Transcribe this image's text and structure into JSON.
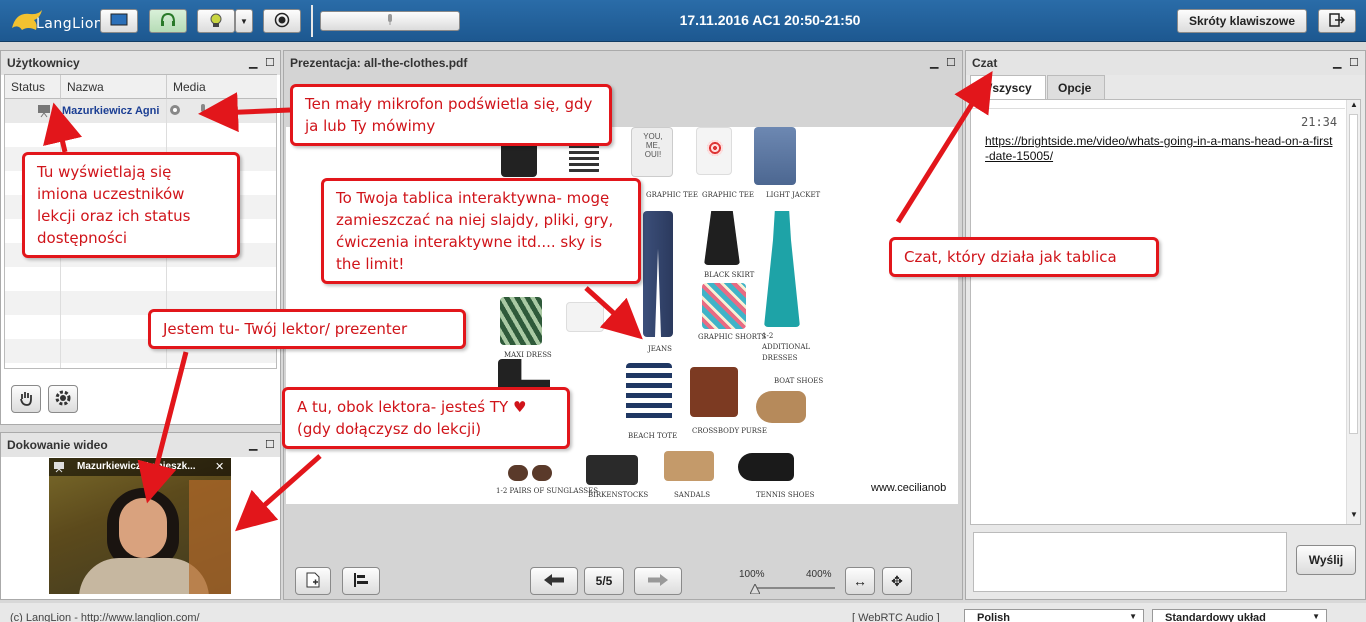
{
  "app": {
    "logo_text": "LangLion",
    "session_title": "17.11.2016 AC1 20:50-21:50",
    "shortcuts_label": "Skróty klawiszowe"
  },
  "users_panel": {
    "title": "Użytkownicy",
    "columns": [
      "Status",
      "Nazwa",
      "Media"
    ],
    "rows": [
      {
        "name": "Mazurkiewicz Agni"
      }
    ]
  },
  "video_panel": {
    "title": "Dokowanie wideo",
    "user_name": "Mazurkiewicz Agnieszk...",
    "close_label": "✕"
  },
  "presentation": {
    "title": "Prezentacja: all-the-clothes.pdf",
    "page_indicator": "5/5",
    "zoom_min": "100%",
    "zoom_max": "400%",
    "zoom_level": 0,
    "watermark": "www.cecilianob",
    "captions": [
      "GRAPHIC TEE",
      "GRAPHIC TEE",
      "LIGHT JACKET",
      "BLACK SKIRT",
      "JEANS",
      "GRAPHIC SHORTS",
      "1-2 ADDITIONAL DRESSES",
      "MAXI DRESS",
      "BEACH TOTE",
      "CROSSBODY PURSE",
      "BOAT SHOES",
      "1-2 PAIRS OF SUNGLASSES",
      "BIRKENSTOCKS",
      "SANDALS",
      "TENNIS SHOES"
    ],
    "tee_text": "YOU, ME, OUI!"
  },
  "chat": {
    "title": "Czat",
    "tabs": [
      "Wszyscy",
      "Opcje"
    ],
    "message_time": "21:34",
    "message_link": "https://brightside.me/video/whats-going-in-a-mans-head-on-a-first-date-15005/",
    "send_label": "Wyślij"
  },
  "footer": {
    "copyright": "(c) LangLion - http://www.langlion.com/",
    "audio_label": "[ WebRTC Audio ]",
    "language": "Polish",
    "layout": "Standardowy układ"
  },
  "callouts": {
    "mic": "Ten mały mikrofon podświetla się, gdy ja lub Ty mówimy",
    "users": "Tu wyświetlają się imiona uczestników lekcji oraz ich status dostępności",
    "board": "To Twoja tablica interaktywna- mogę zamieszczać na niej slajdy, pliki, gry, ćwiczenia interaktywne itd.... sky is the limit!",
    "chat": "Czat, który działa jak tablica",
    "teacher": "Jestem tu- Twój lektor/ prezenter",
    "you": "A tu, obok lektora- jesteś TY ♥ (gdy dołączysz do lekcji)"
  }
}
